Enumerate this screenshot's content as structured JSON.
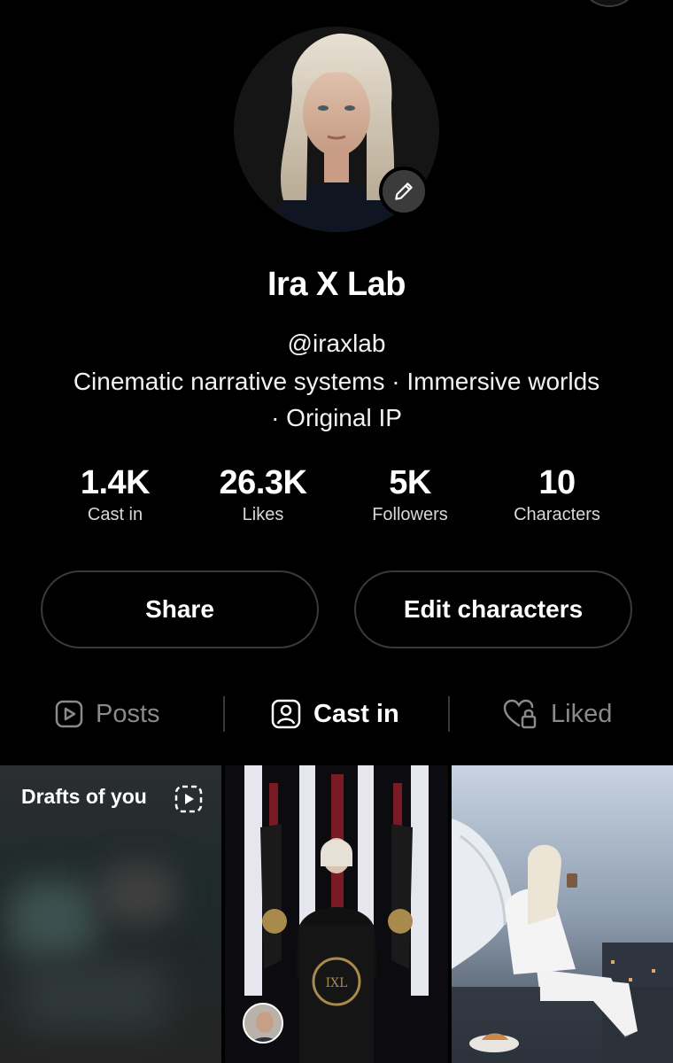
{
  "profile": {
    "name": "Ira X Lab",
    "handle": "@iraxlab",
    "bio_line1": "Cinematic narrative systems · Immersive worlds",
    "bio_line2": "· Original IP"
  },
  "stats": [
    {
      "value": "1.4K",
      "label": "Cast in"
    },
    {
      "value": "26.3K",
      "label": "Likes"
    },
    {
      "value": "5K",
      "label": "Followers"
    },
    {
      "value": "10",
      "label": "Characters"
    }
  ],
  "buttons": {
    "share": "Share",
    "edit_characters": "Edit characters"
  },
  "tabs": [
    {
      "label": "Posts",
      "icon": "play-square-icon",
      "active": false
    },
    {
      "label": "Cast in",
      "icon": "person-square-icon",
      "active": true
    },
    {
      "label": "Liked",
      "icon": "heart-lock-icon",
      "active": false
    }
  ],
  "grid": {
    "drafts_label": "Drafts of you"
  },
  "colors": {
    "background": "#000000",
    "inactive_text": "#8a8a8a",
    "border": "#3a3a3a"
  }
}
